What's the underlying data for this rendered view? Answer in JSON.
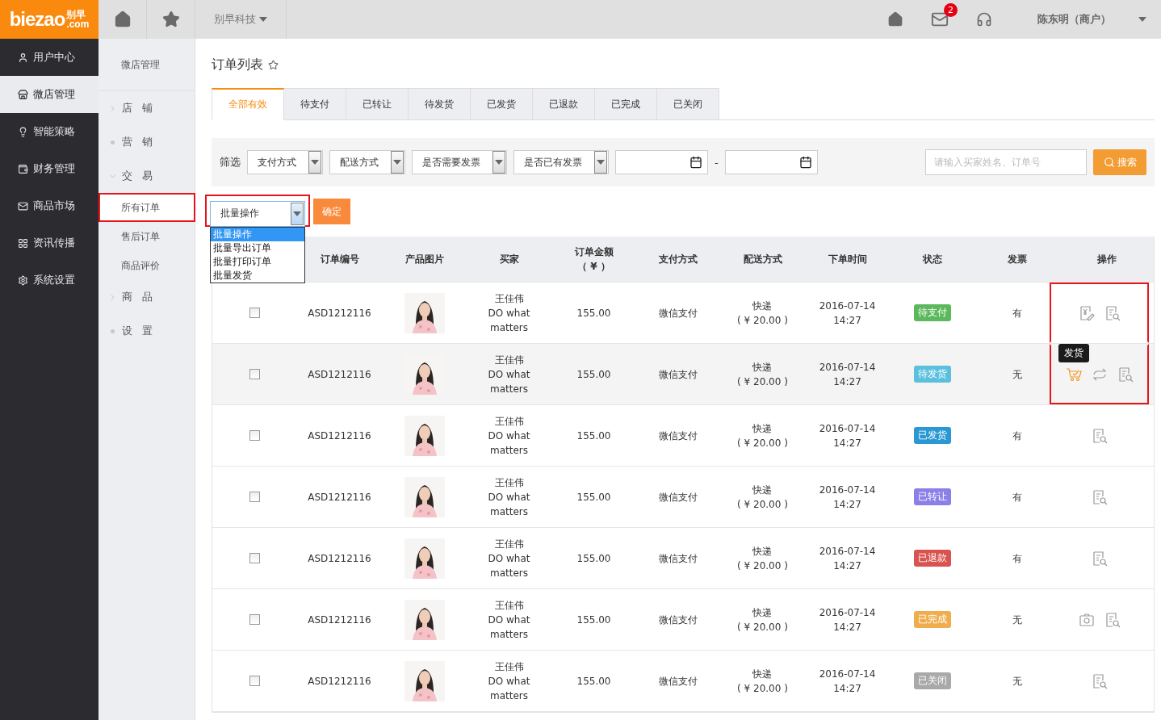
{
  "topbar": {
    "logo_text": "biezao",
    "logo_cn": "别早",
    "logo_domain": ".com",
    "company": "别早科技",
    "badge": "2",
    "user": "陈东明（商户）"
  },
  "sidebar": {
    "items": [
      {
        "label": "用户中心",
        "selected": false
      },
      {
        "label": "微店管理",
        "selected": true
      },
      {
        "label": "智能策略",
        "selected": false
      },
      {
        "label": "财务管理",
        "selected": false
      },
      {
        "label": "商品市场",
        "selected": false
      },
      {
        "label": "资讯传播",
        "selected": false
      },
      {
        "label": "系统设置",
        "selected": false
      }
    ]
  },
  "subnav": {
    "title": "微店管理",
    "groups": [
      {
        "label": "店 铺",
        "kind": "chevron",
        "expanded": false
      },
      {
        "label": "营 销",
        "kind": "dot"
      },
      {
        "label": "交 易",
        "kind": "chevron",
        "expanded": true,
        "children": [
          {
            "label": "所有订单",
            "selected": true,
            "highlighted": true
          },
          {
            "label": "售后订单",
            "selected": false,
            "highlighted": false
          },
          {
            "label": "商品评价",
            "selected": false,
            "highlighted": false
          }
        ]
      },
      {
        "label": "商 品",
        "kind": "chevron",
        "expanded": false
      },
      {
        "label": "设 置",
        "kind": "dot"
      }
    ]
  },
  "page_title": "订单列表",
  "tabs": [
    {
      "label": "全部有效",
      "selected": true
    },
    {
      "label": "待支付",
      "selected": false
    },
    {
      "label": "已转让",
      "selected": false
    },
    {
      "label": "待发货",
      "selected": false
    },
    {
      "label": "已发货",
      "selected": false
    },
    {
      "label": "已退款",
      "selected": false
    },
    {
      "label": "已完成",
      "selected": false
    },
    {
      "label": "已关闭",
      "selected": false
    }
  ],
  "filters": {
    "label": "筛选",
    "selects": [
      "支付方式",
      "配送方式",
      "是否需要发票",
      "是否已有发票"
    ],
    "date_separator": "-",
    "search_placeholder": "请输入买家姓名、订单号",
    "search_button": "搜索"
  },
  "bulk_actions": {
    "value": "批量操作",
    "open": true,
    "highlighted": true,
    "confirm": "确定",
    "options": [
      {
        "label": "批量操作",
        "selected": true
      },
      {
        "label": "批量导出订单",
        "selected": false
      },
      {
        "label": "批量打印订单",
        "selected": false
      },
      {
        "label": "批量发货",
        "selected": false
      }
    ]
  },
  "table": {
    "columns": [
      "订单编号",
      "产品图片",
      "买家",
      "订单金额（ ¥ ）",
      "支付方式",
      "配送方式",
      "下单时间",
      "状态",
      "发票",
      "操作"
    ],
    "rows": [
      {
        "checked": false,
        "order": "ASD1212116",
        "buyer": "王佳伟",
        "buyer_note": "DO what matters",
        "amount": "155.00",
        "payment": "微信支付",
        "shipping": "快递",
        "shipping_fee": "( ¥ 20.00 )",
        "time": "2016-07-14 14:27",
        "status": "待支付",
        "color": "#5cb85c",
        "invoice": "有",
        "highlighted": true,
        "actions": [
          {
            "kind": "pay"
          },
          {
            "kind": "view"
          }
        ]
      },
      {
        "checked": false,
        "order": "ASD1212116",
        "buyer": "王佳伟",
        "buyer_note": "DO what matters",
        "amount": "155.00",
        "payment": "微信支付",
        "shipping": "快递",
        "shipping_fee": "( ¥ 20.00 )",
        "time": "2016-07-14 14:27",
        "status": "待发货",
        "color": "#5bc0de",
        "invoice": "无",
        "hovered": true,
        "highlighted": true,
        "actions": [
          {
            "kind": "ship",
            "tooltip": "发货"
          },
          {
            "kind": "exchange"
          },
          {
            "kind": "view"
          }
        ]
      },
      {
        "checked": false,
        "order": "ASD1212116",
        "buyer": "王佳伟",
        "buyer_note": "DO what matters",
        "amount": "155.00",
        "payment": "微信支付",
        "shipping": "快递",
        "shipping_fee": "( ¥ 20.00 )",
        "time": "2016-07-14 14:27",
        "status": "已发货",
        "color": "#2a98d2",
        "invoice": "有",
        "highlighted": false,
        "actions": [
          {
            "kind": "view"
          }
        ]
      },
      {
        "checked": false,
        "order": "ASD1212116",
        "buyer": "王佳伟",
        "buyer_note": "DO what matters",
        "amount": "155.00",
        "payment": "微信支付",
        "shipping": "快递",
        "shipping_fee": "( ¥ 20.00 )",
        "time": "2016-07-14 14:27",
        "status": "已转让",
        "color": "#8b7fe8",
        "invoice": "有",
        "highlighted": false,
        "actions": [
          {
            "kind": "view"
          }
        ]
      },
      {
        "checked": false,
        "order": "ASD1212116",
        "buyer": "王佳伟",
        "buyer_note": "DO what matters",
        "amount": "155.00",
        "payment": "微信支付",
        "shipping": "快递",
        "shipping_fee": "( ¥ 20.00 )",
        "time": "2016-07-14 14:27",
        "status": "已退款",
        "color": "#d9534f",
        "invoice": "有",
        "highlighted": false,
        "actions": [
          {
            "kind": "view"
          }
        ]
      },
      {
        "checked": false,
        "order": "ASD1212116",
        "buyer": "王佳伟",
        "buyer_note": "DO what matters",
        "amount": "155.00",
        "payment": "微信支付",
        "shipping": "快递",
        "shipping_fee": "( ¥ 20.00 )",
        "time": "2016-07-14 14:27",
        "status": "已完成",
        "color": "#f0ad4e",
        "invoice": "无",
        "highlighted": false,
        "actions": [
          {
            "kind": "camera"
          },
          {
            "kind": "view"
          }
        ]
      },
      {
        "checked": false,
        "order": "ASD1212116",
        "buyer": "王佳伟",
        "buyer_note": "DO what matters",
        "amount": "155.00",
        "payment": "微信支付",
        "shipping": "快递",
        "shipping_fee": "( ¥ 20.00 )",
        "time": "2016-07-14 14:27",
        "status": "已关闭",
        "color": "#a9a9a9",
        "invoice": "无",
        "highlighted": false,
        "actions": [
          {
            "kind": "view"
          }
        ]
      }
    ]
  }
}
